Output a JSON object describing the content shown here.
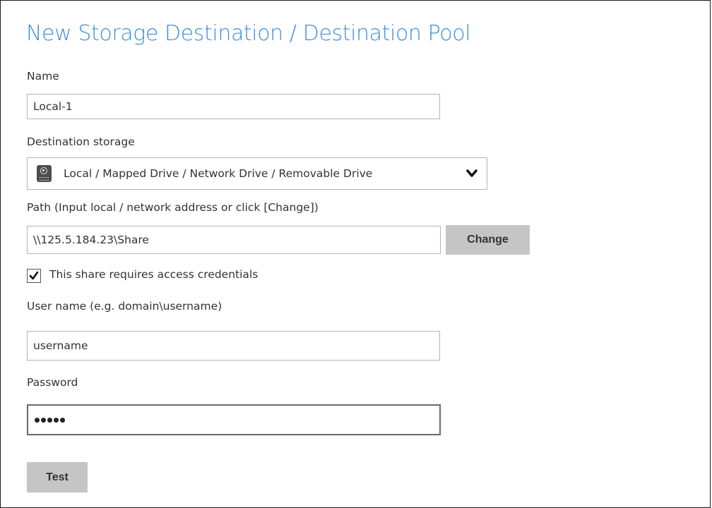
{
  "dialog": {
    "title": "New Storage Destination / Destination Pool"
  },
  "form": {
    "name_label": "Name",
    "name_value": "Local-1",
    "destination_storage_label": "Destination storage",
    "destination_storage_value": "Local / Mapped Drive / Network Drive / Removable Drive",
    "destination_storage_icon": "hard-drive-icon",
    "path_label": "Path (Input local / network address or click [Change])",
    "path_value": "\\\\125.5.184.23\\Share",
    "change_button": "Change",
    "credentials_checkbox_label": "This share requires access credentials",
    "credentials_checked": true,
    "username_label": "User name (e.g. domain\\username)",
    "username_value": "username",
    "password_label": "Password",
    "password_masked": "●●●●●",
    "test_button": "Test"
  },
  "colors": {
    "title": "#3f8ee0",
    "button_bg": "#c5c5c5",
    "input_border": "#b4b4b4"
  }
}
